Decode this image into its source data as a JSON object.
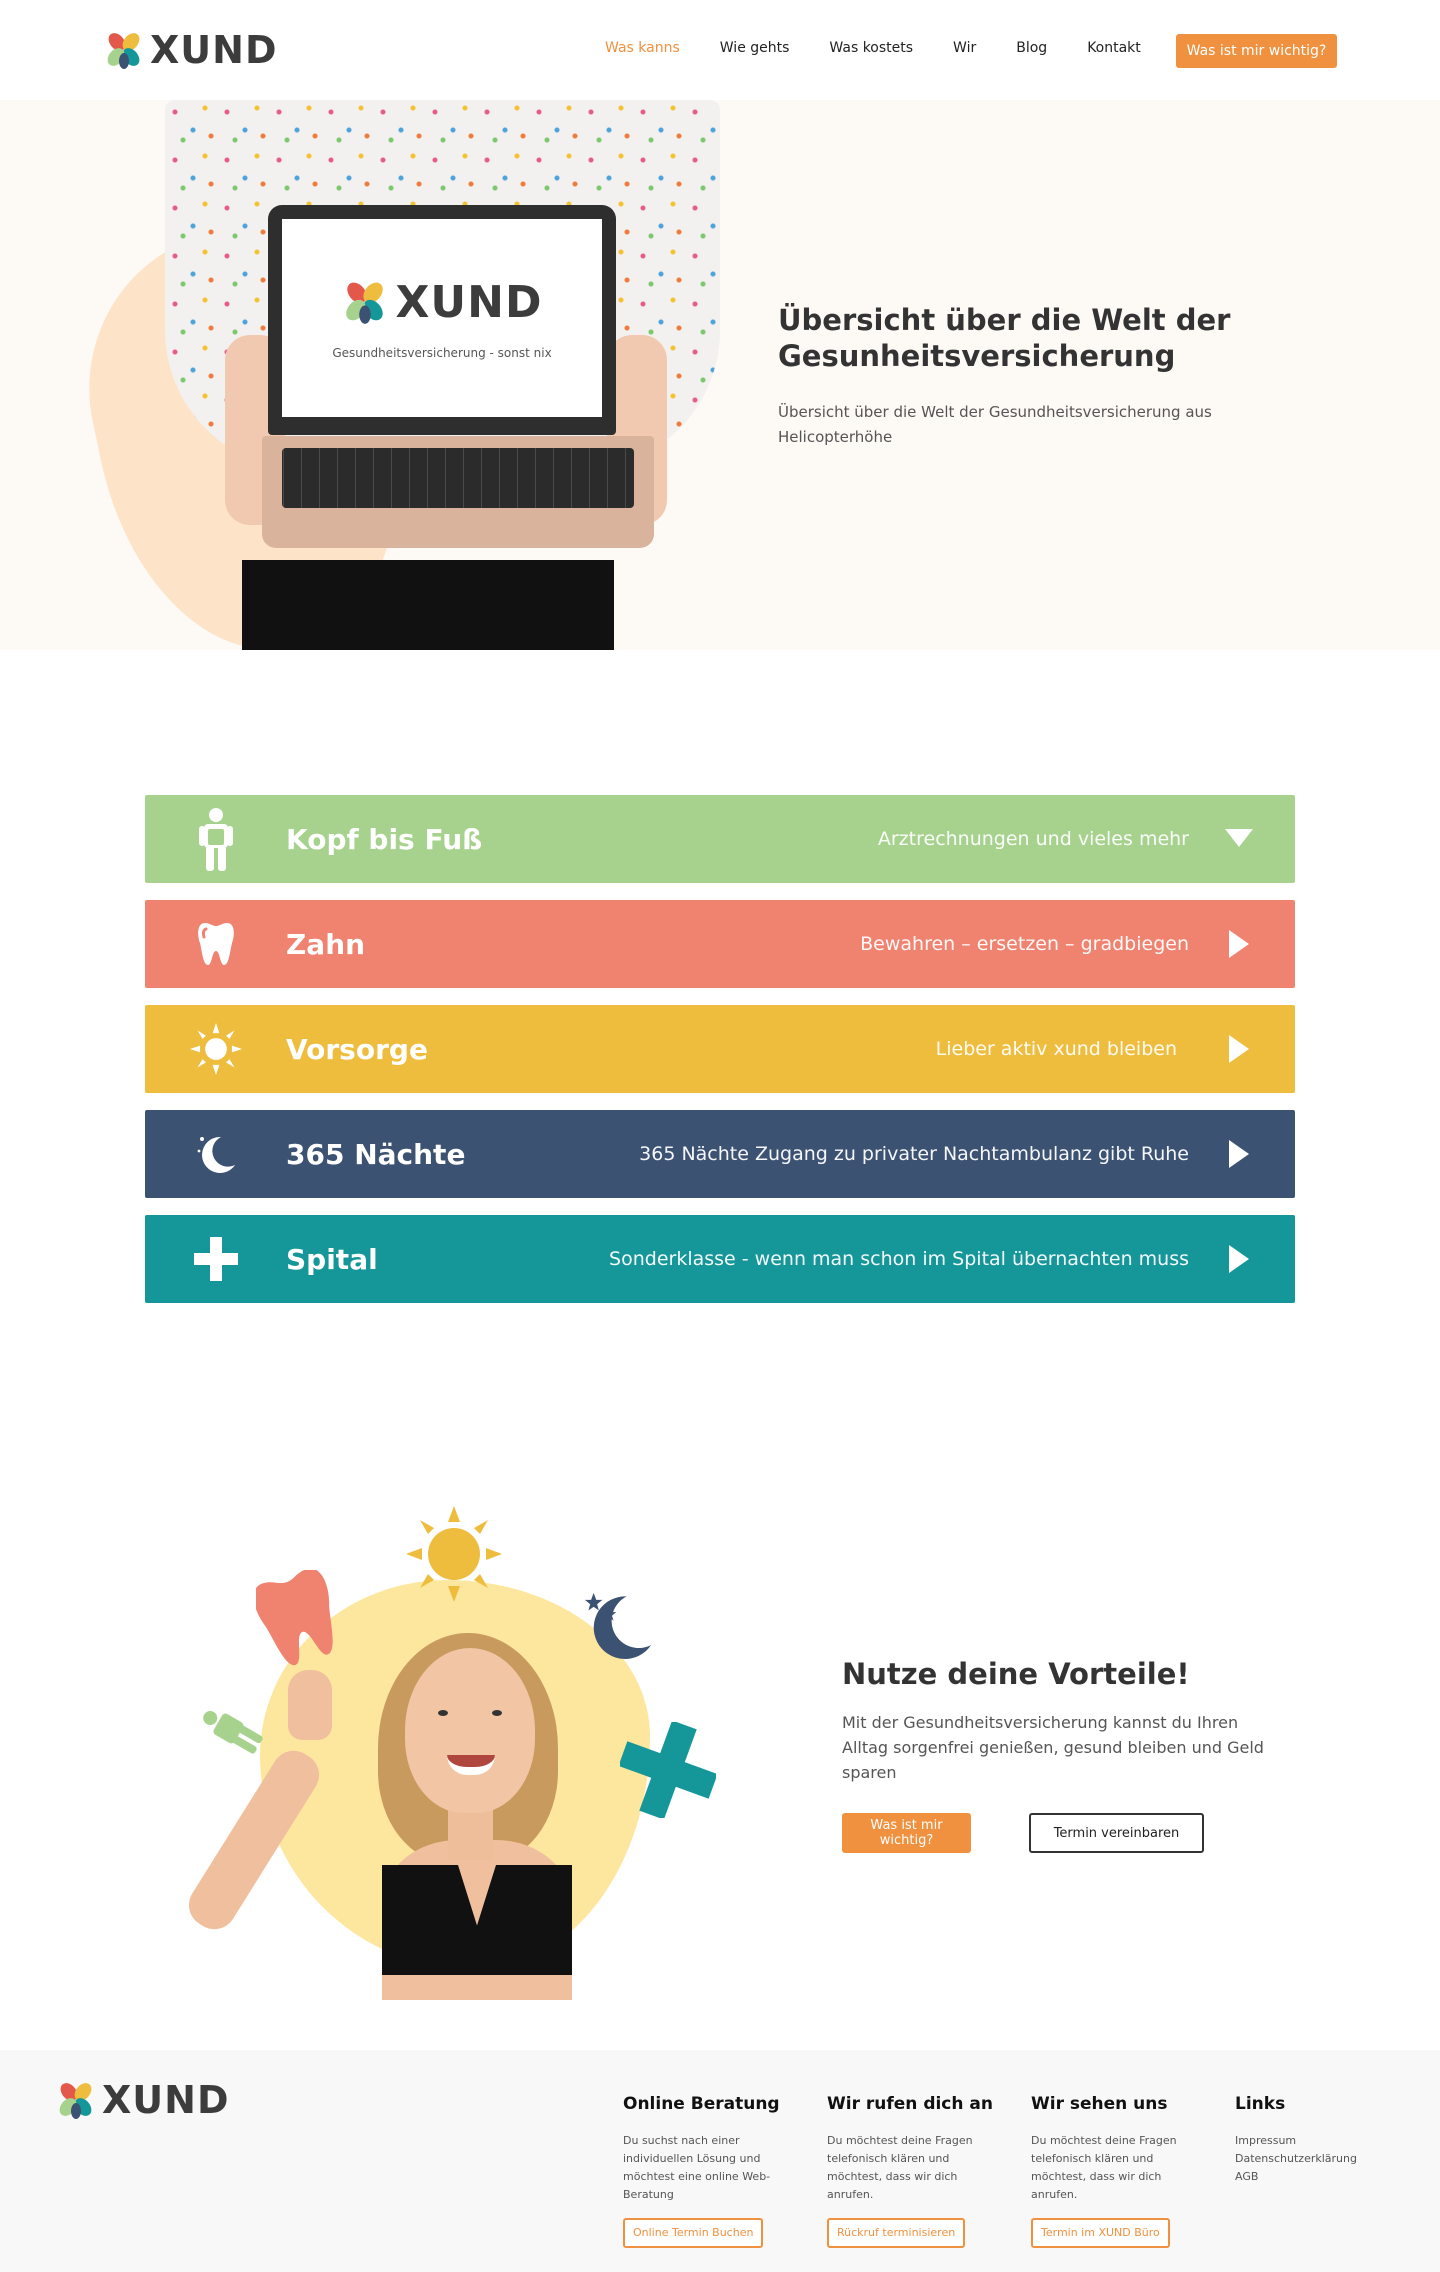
{
  "brand": {
    "name": "XUND",
    "tagline": "Gesundheitsversicherung - sonst nix"
  },
  "nav": {
    "items": [
      {
        "label": "Was kanns",
        "active": true
      },
      {
        "label": "Wie gehts",
        "active": false
      },
      {
        "label": "Was kostets",
        "active": false
      },
      {
        "label": "Wir",
        "active": false
      },
      {
        "label": "Blog",
        "active": false
      },
      {
        "label": "Kontakt",
        "active": false
      }
    ],
    "cta": "Was ist mir wichtig?"
  },
  "hero": {
    "title": "Übersicht über die Welt der Gesunheitsversicherung",
    "subtitle": "Übersicht über die Welt der Gesundheitsversicherung aus Helicopterhöhe"
  },
  "accordion": [
    {
      "title": "Kopf bis Fuß",
      "subtitle": "Arztrechnungen und vieles mehr",
      "color": "#a7d28d",
      "icon": "person-icon",
      "expanded": true
    },
    {
      "title": "Zahn",
      "subtitle": "Bewahren – ersetzen – gradbiegen",
      "color": "#f08270",
      "icon": "tooth-icon",
      "expanded": false
    },
    {
      "title": "Vorsorge",
      "subtitle": "Lieber aktiv xund bleiben",
      "color": "#efbd3e",
      "icon": "sun-icon",
      "expanded": false
    },
    {
      "title": "365 Nächte",
      "subtitle": "365 Nächte Zugang zu privater Nachtambulanz gibt Ruhe",
      "color": "#3c5272",
      "icon": "moon-icon",
      "expanded": false
    },
    {
      "title": "Spital",
      "subtitle": "Sonderklasse - wenn man schon im Spital übernachten muss",
      "color": "#15979a",
      "icon": "cross-icon",
      "expanded": false
    }
  ],
  "benefits": {
    "title": "Nutze deine Vorteile!",
    "text": "Mit der Gesundheitsversicherung kannst du Ihren Alltag sorgenfrei genießen, gesund bleiben und Geld sparen",
    "primary_button": "Was ist mir wichtig?",
    "secondary_button": "Termin vereinbaren"
  },
  "footer": {
    "columns": [
      {
        "heading": "Online Beratung",
        "text": "Du suchst nach einer individuellen Lösung und möchtest eine online Web-Beratung",
        "button": "Online Termin Buchen"
      },
      {
        "heading": "Wir rufen dich an",
        "text": "Du möchtest deine Fragen telefonisch klären und möchtest, dass wir dich anrufen.",
        "button": "Rückruf terminisieren"
      },
      {
        "heading": "Wir sehen uns",
        "text": "Du möchtest deine Fragen telefonisch klären und möchtest, dass wir dich anrufen.",
        "button": "Termin im XUND Büro"
      }
    ],
    "links": {
      "heading": "Links",
      "items": [
        "Impressum",
        "Datenschutzerklärung",
        "AGB"
      ]
    }
  },
  "colors": {
    "accent": "#f0913f",
    "hero_bg": "#fdf9f5",
    "footer_bg": "#f8f8f8"
  }
}
